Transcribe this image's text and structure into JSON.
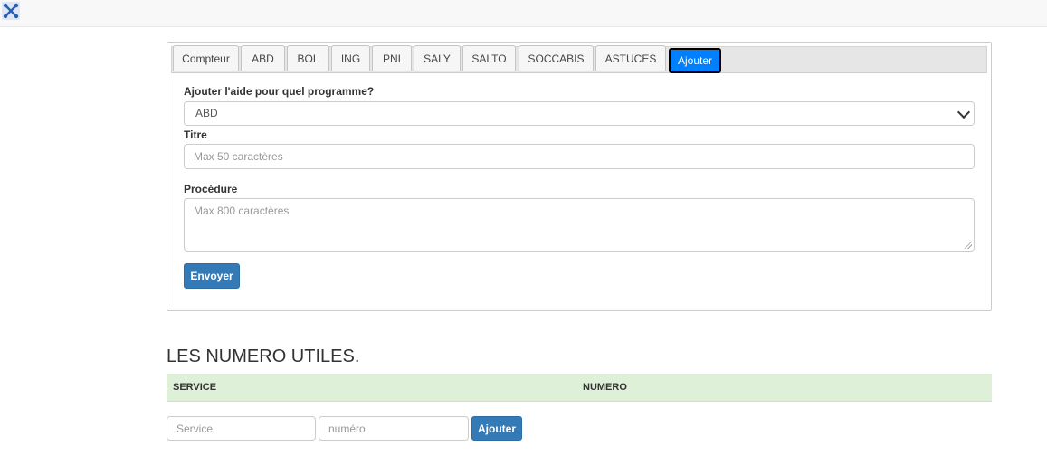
{
  "tabs": [
    {
      "label": "Compteur",
      "active": false
    },
    {
      "label": "ABD",
      "active": false
    },
    {
      "label": "BOL",
      "active": false
    },
    {
      "label": "ING",
      "active": false
    },
    {
      "label": "PNI",
      "active": false
    },
    {
      "label": "SALY",
      "active": false
    },
    {
      "label": "SALTO",
      "active": false
    },
    {
      "label": "SOCCABIS",
      "active": false
    },
    {
      "label": "ASTUCES",
      "active": false
    },
    {
      "label": "Ajouter",
      "active": true
    }
  ],
  "form": {
    "program_label": "Ajouter l'aide pour quel programme?",
    "program_value": "ABD",
    "title_label": "Titre",
    "title_placeholder": "Max 50 caractères",
    "procedure_label": "Procédure",
    "procedure_placeholder": "Max 800 caractères",
    "submit_label": "Envoyer"
  },
  "numbers": {
    "heading": "LES NUMERO UTILES.",
    "columns": [
      "SERVICE",
      "NUMERO"
    ],
    "service_placeholder": "Service",
    "numero_placeholder": "numéro",
    "add_label": "Ajouter"
  },
  "colors": {
    "active_tab": "#007fff",
    "primary_button": "#337ab7",
    "table_header": "#dff0d8"
  }
}
